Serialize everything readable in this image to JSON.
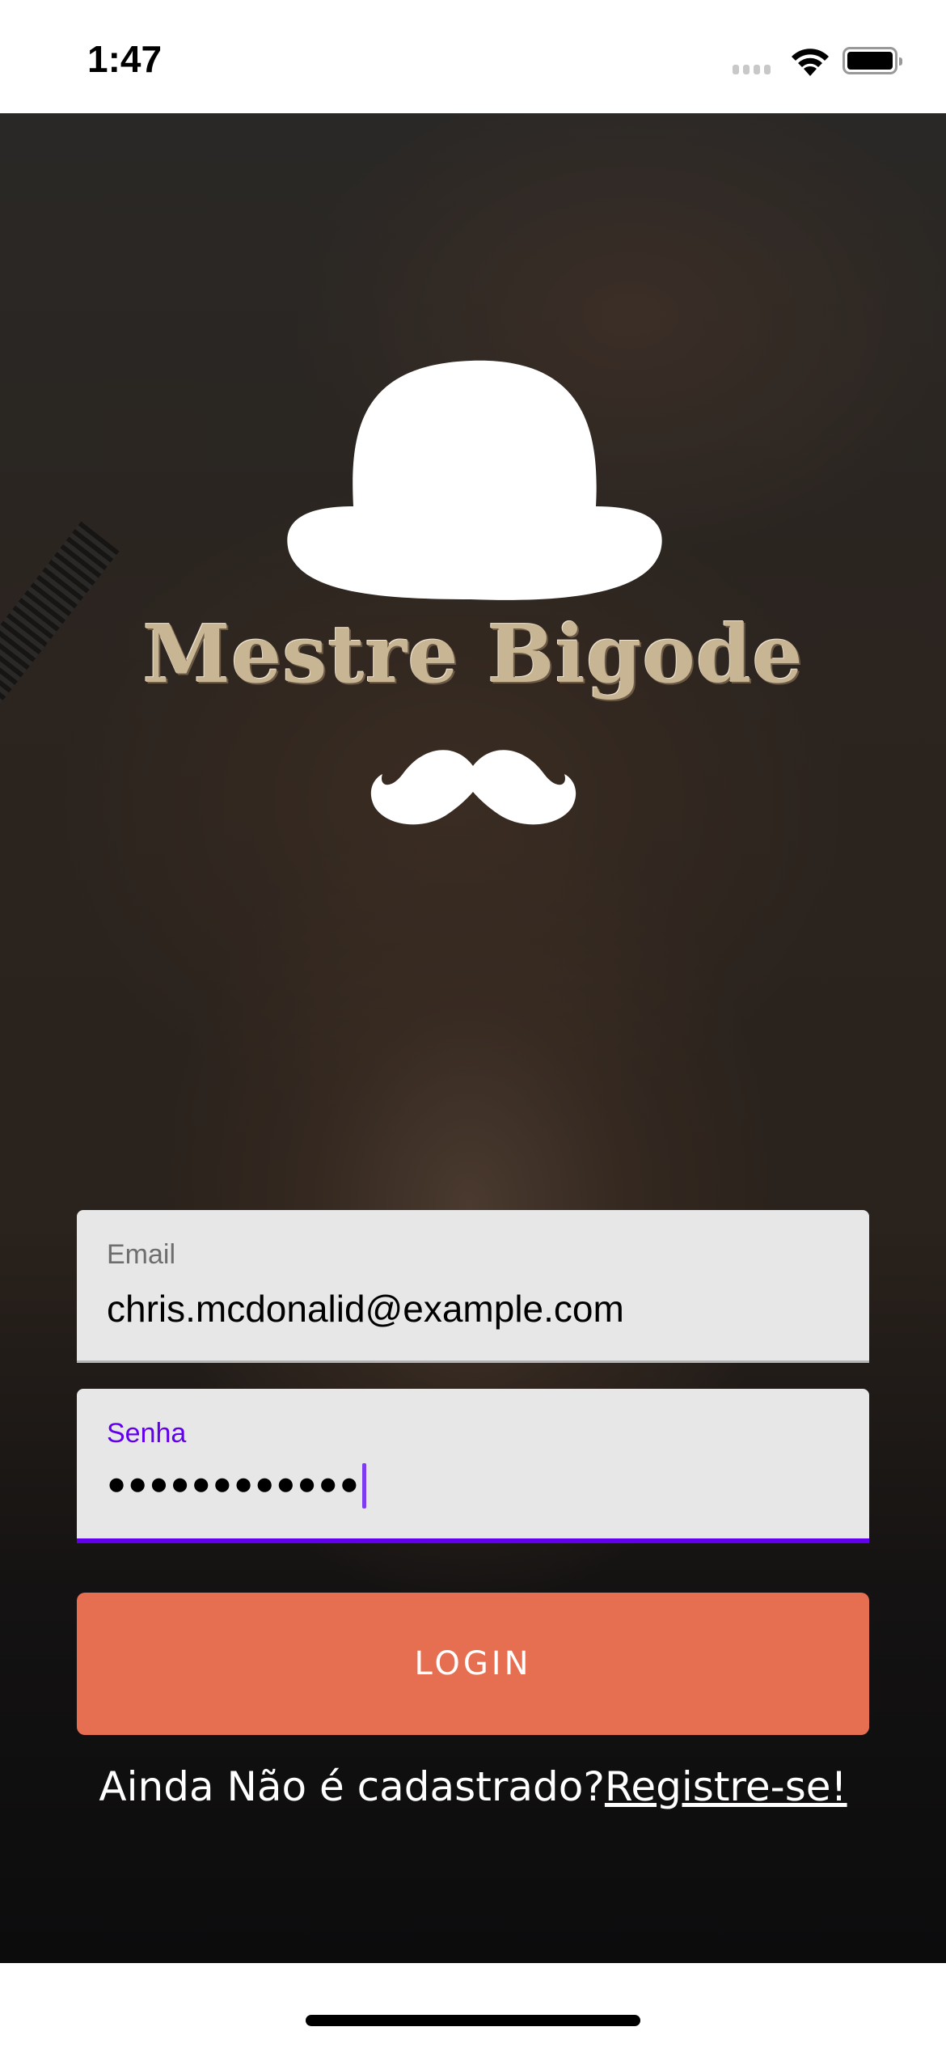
{
  "status_bar": {
    "time": "1:47"
  },
  "logo": {
    "title": "Mestre Bigode"
  },
  "form": {
    "email": {
      "label": "Email",
      "value": "chris.mcdonalid@example.com"
    },
    "password": {
      "label": "Senha",
      "value": "●●●●●●●●●●●●"
    },
    "login_label": "LOGIN",
    "register_prompt": "Ainda Não é cadastrado?",
    "register_link": "Registre-se!"
  },
  "colors": {
    "accent": "#6200ee",
    "button": "#e66f52"
  }
}
